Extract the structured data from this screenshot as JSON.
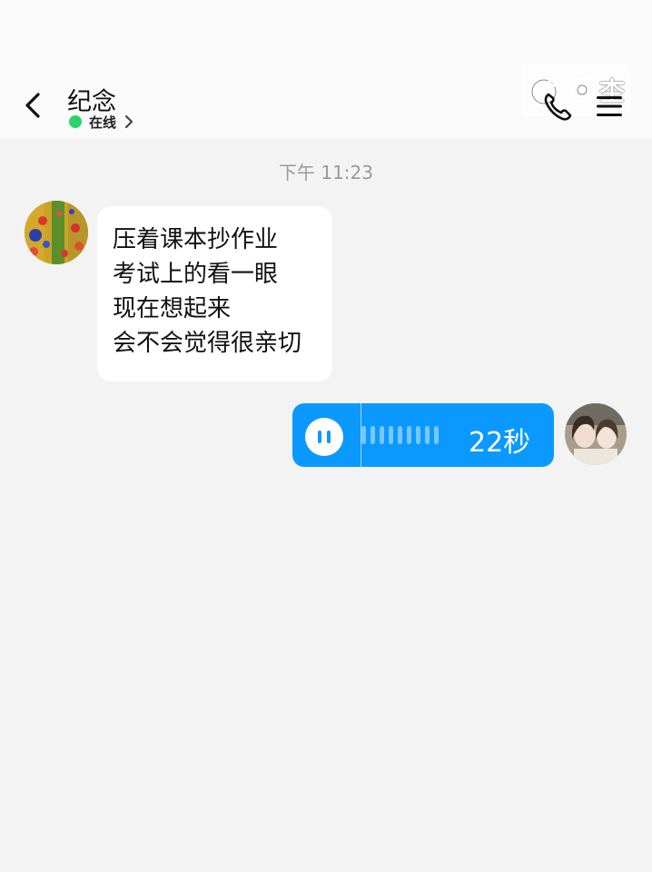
{
  "header": {
    "title": "纪念",
    "status": "在线",
    "watermark_text": "杢",
    "icons": [
      "back-arrow-icon",
      "chevron-right-icon",
      "phone-icon",
      "menu-icon"
    ]
  },
  "chat": {
    "timestamp": "下午 11:23",
    "incoming": {
      "lines": [
        "压着课本抄作业",
        "考试上的看一眼",
        "现在想起来",
        "会不会觉得很亲切"
      ]
    },
    "outgoing_voice": {
      "duration": "22秒",
      "state_icon": "pause-icon"
    }
  },
  "colors": {
    "accent": "#0b99ff",
    "online": "#2ad36b",
    "background": "#f3f3f4",
    "header": "#fafafa"
  }
}
